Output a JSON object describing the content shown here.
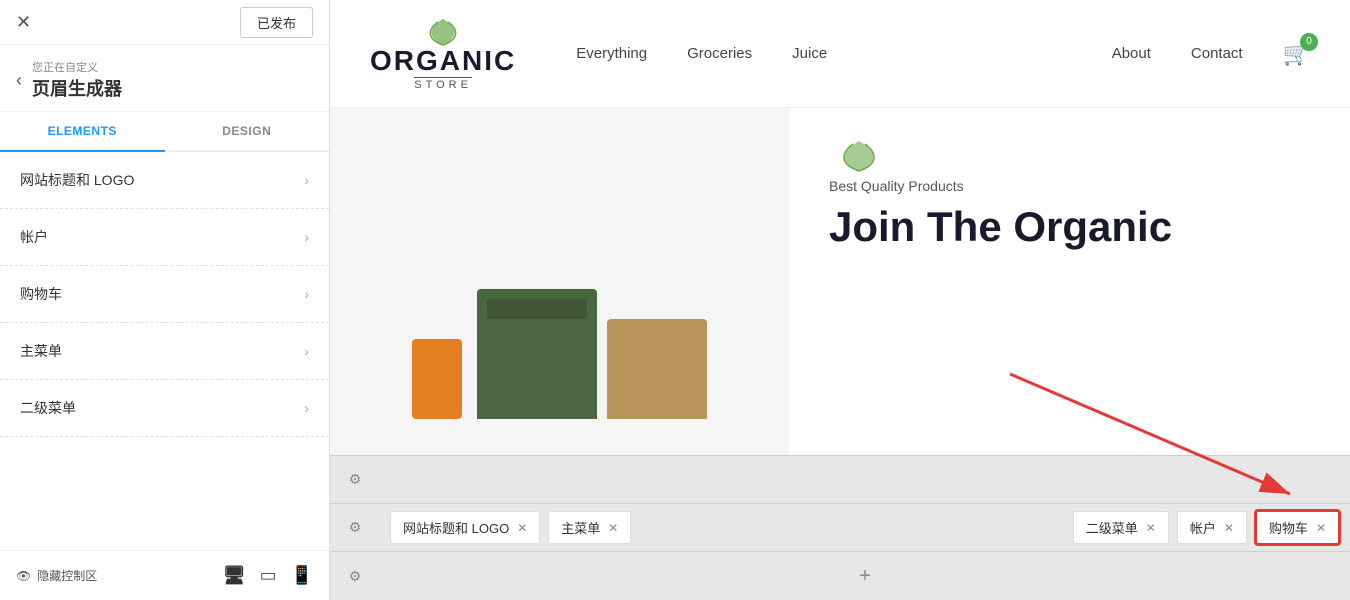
{
  "leftPanel": {
    "closeBtn": "✕",
    "publishBtn": "已发布",
    "backArrow": "‹",
    "subtitle": "您正在自定义",
    "title": "页眉生成器",
    "tabs": [
      {
        "label": "ELEMENTS",
        "active": true
      },
      {
        "label": "DESIGN",
        "active": false
      }
    ],
    "menuItems": [
      {
        "label": "网站标题和 LOGO"
      },
      {
        "label": "帐户"
      },
      {
        "label": "购物车"
      },
      {
        "label": "主菜单"
      },
      {
        "label": "二级菜单"
      }
    ],
    "hidePanelBtn": "隐藏控制区",
    "deviceIcons": [
      "desktop",
      "tablet",
      "mobile"
    ]
  },
  "siteHeader": {
    "logoName": "ORGANIC",
    "logoStore": "STORE",
    "navLinks": [
      {
        "label": "Everything"
      },
      {
        "label": "Groceries"
      },
      {
        "label": "Juice"
      },
      {
        "label": "About"
      },
      {
        "label": "Contact"
      }
    ],
    "cartCount": "0"
  },
  "heroSection": {
    "leafIcon": "🌿",
    "subtitle": "Best Quality Products",
    "title": "Join The Organic"
  },
  "builderRows": [
    {
      "id": "row1",
      "chips": [],
      "empty": true
    },
    {
      "id": "row2",
      "chips": [
        {
          "label": "网站标题和 LOGO",
          "id": "logo-chip"
        },
        {
          "label": "主菜单",
          "id": "main-menu-chip"
        },
        {
          "spacer": true
        },
        {
          "label": "二级菜单",
          "id": "sub-menu-chip"
        },
        {
          "label": "帐户",
          "id": "account-chip"
        },
        {
          "label": "购物车",
          "id": "cart-chip",
          "highlighted": true
        }
      ]
    },
    {
      "id": "row3",
      "chips": [],
      "hasPlus": true
    }
  ],
  "icons": {
    "gear": "⚙",
    "close": "✕",
    "plus": "+",
    "eye": "👁",
    "desktop": "🖥",
    "tablet": "▭",
    "mobile": "📱",
    "cart": "🛒",
    "back": "‹"
  }
}
